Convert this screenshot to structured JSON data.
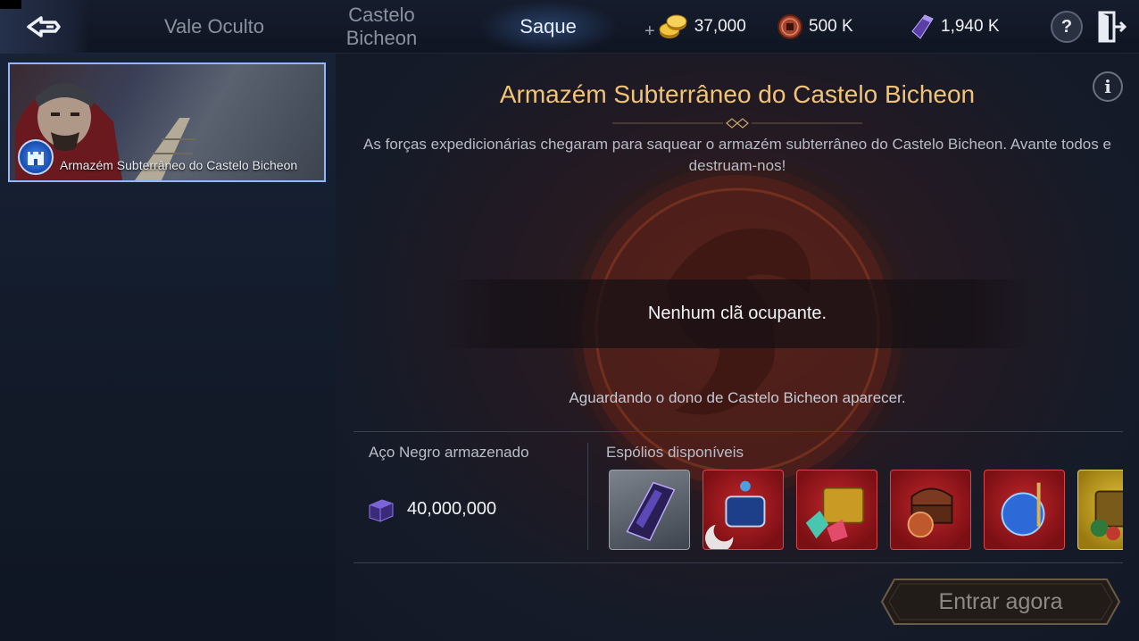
{
  "header": {
    "tabs": [
      {
        "label": "Vale Oculto",
        "active": false
      },
      {
        "label": "Castelo\nBicheon",
        "active": false
      },
      {
        "label": "Saque",
        "active": true
      }
    ],
    "currencies": [
      {
        "icon": "gold-coins-icon",
        "value": "37,000"
      },
      {
        "icon": "copper-coin-icon",
        "value": "500 K"
      },
      {
        "icon": "black-steel-icon",
        "value": "1,940 K"
      }
    ],
    "help_label": "?"
  },
  "sidebar": {
    "items": [
      {
        "label": "Armazém Subterrâneo do Castelo Bicheon",
        "selected": true
      }
    ]
  },
  "main": {
    "title": "Armazém Subterrâneo do Castelo Bicheon",
    "description": "As forças expedicionárias chegaram para saquear o armazém subterrâneo do Castelo Bicheon. Avante todos e destruam-nos!",
    "occupant_status": "Nenhum clã ocupante.",
    "waiting_text": "Aguardando o dono de Castelo Bicheon aparecer.",
    "info_label": "i",
    "stored_label": "Aço Negro armazenado",
    "stored_value": "40,000,000",
    "spoils_label": "Espólios disponíveis",
    "spoils": [
      {
        "icon": "black-steel-ingot-icon",
        "rarity": "gray"
      },
      {
        "icon": "ornate-chest-icon",
        "rarity": "red"
      },
      {
        "icon": "treasure-chest-gems-icon",
        "rarity": "red"
      },
      {
        "icon": "wooden-chest-icon",
        "rarity": "red"
      },
      {
        "icon": "moon-pouch-icon",
        "rarity": "red"
      },
      {
        "icon": "golden-chest-icon",
        "rarity": "gold"
      }
    ],
    "enter_button": "Entrar agora"
  },
  "colors": {
    "title": "#f1c377",
    "accent_blue": "#8fb8ff",
    "rarity_red": "#b5202a",
    "rarity_gold": "#d9b52e"
  }
}
